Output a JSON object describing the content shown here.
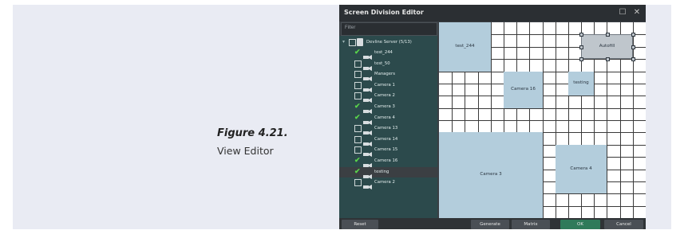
{
  "caption": {
    "figure_number": "Figure 4.21.",
    "title": "View Editor"
  },
  "window": {
    "title": "Screen Division Editor",
    "maximize_glyph": "☐",
    "close_glyph": "✕"
  },
  "filter": {
    "placeholder": "Filter"
  },
  "tree": {
    "server": {
      "label": "Devline Server (5/13)",
      "checked": false,
      "expanded": true
    },
    "cameras": [
      {
        "label": "test_244",
        "checked": true
      },
      {
        "label": "test_50",
        "checked": false
      },
      {
        "label": "Managers",
        "checked": false
      },
      {
        "label": "Camera 1",
        "checked": false
      },
      {
        "label": "Camera 2",
        "checked": false
      },
      {
        "label": "Camera 3",
        "checked": true
      },
      {
        "label": "Camera 4",
        "checked": true
      },
      {
        "label": "Camera 13",
        "checked": false
      },
      {
        "label": "Camera 14",
        "checked": false
      },
      {
        "label": "Camera 15",
        "checked": false
      },
      {
        "label": "Camera 16",
        "checked": true
      },
      {
        "label": "testing",
        "checked": true,
        "selected": true
      },
      {
        "label": "Camera 2",
        "checked": false
      }
    ]
  },
  "grid": {
    "columns": 16,
    "rows": 16,
    "tiles": [
      {
        "label": "test_244",
        "col": 0,
        "row": 0,
        "cols": 4,
        "rows": 4
      },
      {
        "label": "Camera 16",
        "col": 5,
        "row": 4,
        "cols": 3,
        "rows": 3
      },
      {
        "label": "testing",
        "col": 10,
        "row": 4,
        "cols": 2,
        "rows": 2
      },
      {
        "label": "Camera 3",
        "col": 0,
        "row": 9,
        "cols": 8,
        "rows": 7
      },
      {
        "label": "Camera 4",
        "col": 9,
        "row": 10,
        "cols": 4,
        "rows": 4
      },
      {
        "label": "Autofill",
        "col": 11,
        "row": 1,
        "cols": 4,
        "rows": 2,
        "style": "gray"
      }
    ]
  },
  "footer": {
    "reset": "Reset",
    "generate": "Generate",
    "matrix": "Matrix",
    "ok": "OK",
    "cancel": "Cancel"
  },
  "colors": {
    "tree_bg": "#2c4a4c",
    "tile": "#b3cddc",
    "check": "#59d44a",
    "ok_button": "#2f7a5a"
  }
}
